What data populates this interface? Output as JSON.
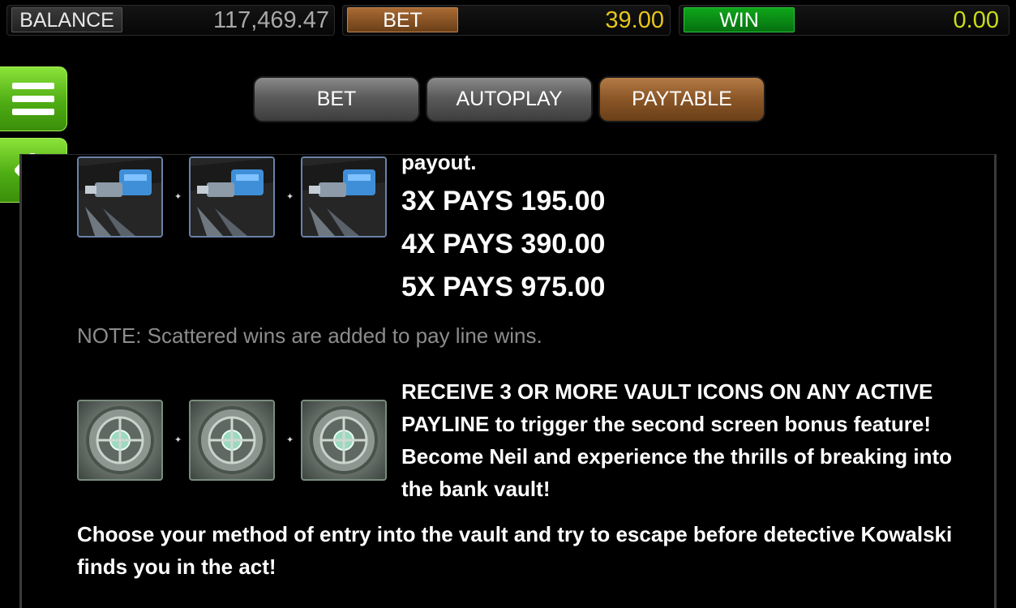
{
  "status_bar": {
    "balance_label": "BALANCE",
    "balance_value": "117,469.47",
    "bet_label": "BET",
    "bet_value": "39.00",
    "win_label": "WIN",
    "win_value": "0.00"
  },
  "tabs": [
    {
      "label": "BET",
      "active": false
    },
    {
      "label": "AUTOPLAY",
      "active": false
    },
    {
      "label": "PAYTABLE",
      "active": true
    }
  ],
  "paytable": {
    "drill_section": {
      "symbol": "drill-icon",
      "continued_text": "payout.",
      "pays": [
        "3X PAYS 195.00",
        "4X PAYS 390.00",
        "5X PAYS 975.00"
      ]
    },
    "note": "NOTE: Scattered wins are added to pay line wins.",
    "vault_section": {
      "symbol": "vault-icon",
      "description": "RECEIVE 3 OR MORE VAULT ICONS ON ANY ACTIVE PAYLINE to trigger the second screen bonus feature! Become Neil and experience the thrills of breaking into the bank vault!"
    },
    "bonus_text": "Choose your method of entry into the vault and try to escape before detective Kowalski finds you in the act!"
  },
  "colors": {
    "bet_accent": "#8a5627",
    "win_accent": "#0fa51a",
    "menu_green": "#4fad14",
    "bet_value": "#e6c51b",
    "win_value": "#c9dc18"
  }
}
